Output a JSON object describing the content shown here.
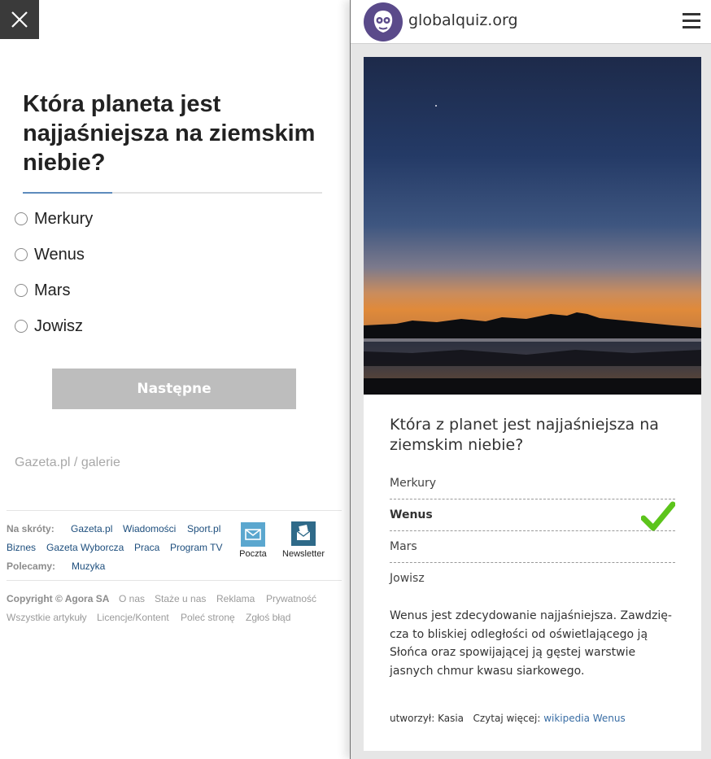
{
  "left": {
    "title": "Która planeta jest najjaśniejsza na ziemskim niebie?",
    "options": [
      "Merkury",
      "Wenus",
      "Mars",
      "Jowisz"
    ],
    "next_button": "Następne",
    "gallery_link": "Gazeta.pl / galerie",
    "footer": {
      "shortcuts_label": "Na skróty:",
      "shortcuts": [
        "Gazeta.pl",
        "Wiadomości",
        "Sport.pl",
        "Biznes",
        "Gazeta Wyborcza",
        "Praca",
        "Program TV"
      ],
      "recommend_label": "Polecamy:",
      "recommend": [
        "Muzyka"
      ],
      "mail_label": "Poczta",
      "newsletter_label": "Newsletter",
      "copyright": "Copyright © Agora SA",
      "links": [
        "O nas",
        "Staże u nas",
        "Reklama",
        "Prywatność",
        "Wszystkie artykuły",
        "Licencje/Kontent",
        "Poleć stronę",
        "Zgłoś błąd"
      ]
    }
  },
  "right": {
    "site_name": "globalquiz.org",
    "question": "Która z planet jest najjaśniejsza na ziemskim niebie?",
    "answers": [
      "Merkury",
      "Wenus",
      "Mars",
      "Jowisz"
    ],
    "correct_answer": "Wenus",
    "explanation": "Wenus jest zdecydowanie najjaśniejsza. Zawdzię­cza to bliskiej odległości od oświetlającego ją Słońca oraz spowijającej ją gęstej warstwie jasnych chmur kwasu siarkowego.",
    "author_text": "utworzył: Kasia",
    "read_more_label": "Czytaj więcej:",
    "read_more_link": "wikipedia Wenus"
  },
  "colors": {
    "accent_blue": "#5d8bbd",
    "check_green": "#5cc41b",
    "link_blue": "#3a6ea5",
    "footer_link": "#1d4e7d",
    "logo_purple": "#5a4a8a"
  },
  "icons": [
    "close-icon",
    "mail-icon",
    "newsletter-icon",
    "logo-icon",
    "hamburger-menu-icon",
    "checkmark-icon"
  ]
}
